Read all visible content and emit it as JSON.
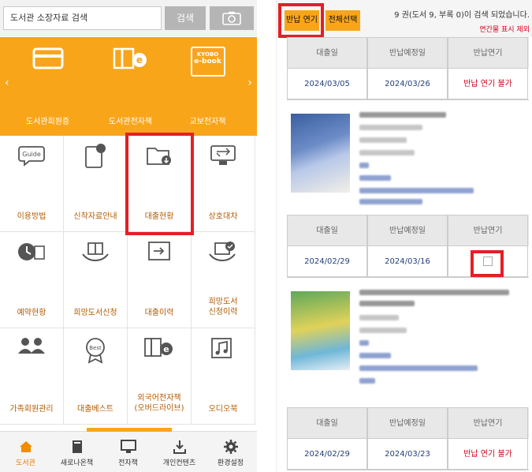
{
  "left": {
    "search": {
      "placeholder": "도서관 소장자료 검색",
      "button": "검색"
    },
    "banner": {
      "items": [
        {
          "label": "도서관회원증",
          "icon": "card-icon"
        },
        {
          "label": "도서관전자책",
          "icon": "ebook-icon"
        },
        {
          "label": "교보전자책",
          "icon": "kyobo-ebook-icon",
          "logo_top": "KYOBO",
          "logo_bottom": "e-book"
        }
      ]
    },
    "menu": [
      {
        "label": "이용방법",
        "icon": "guide-icon"
      },
      {
        "label": "신착자료안내",
        "icon": "new-arrival-icon"
      },
      {
        "label": "대출현황",
        "icon": "loan-status-icon"
      },
      {
        "label": "상호대차",
        "icon": "interlibrary-icon"
      },
      {
        "label": "예약현황",
        "icon": "reservation-icon"
      },
      {
        "label": "희망도서신청",
        "icon": "wish-book-icon"
      },
      {
        "label": "대출이력",
        "icon": "loan-history-icon"
      },
      {
        "label": "희망도서\n신청이력",
        "icon": "wish-history-icon"
      },
      {
        "label": "가족회원관리",
        "icon": "family-icon"
      },
      {
        "label": "대출베스트",
        "icon": "best-icon"
      },
      {
        "label": "외국어전자책\n(오버드라이브)",
        "icon": "foreign-ebook-icon"
      },
      {
        "label": "오디오북",
        "icon": "audiobook-icon"
      }
    ],
    "tabs": [
      {
        "label": "도서관",
        "icon": "home-icon",
        "active": true
      },
      {
        "label": "새로나온책",
        "icon": "book-icon",
        "active": false
      },
      {
        "label": "전자책",
        "icon": "monitor-icon",
        "active": false
      },
      {
        "label": "개인컨텐츠",
        "icon": "download-icon",
        "active": false
      },
      {
        "label": "환경설정",
        "icon": "gear-icon",
        "active": false
      }
    ]
  },
  "right": {
    "buttons": {
      "extend": "반납 연기",
      "select_all": "전체선택"
    },
    "result": "9 권(도서 9, 부록 0)이 검색 되었습니다.",
    "hide_link": "연간물 표시 제외",
    "columns": [
      "대출일",
      "반납예정일",
      "반납연기"
    ],
    "loans": [
      {
        "loan_date": "2024/03/05",
        "due_date": "2024/03/26",
        "extend": "반납 연기 불가"
      },
      {
        "loan_date": "2024/02/29",
        "due_date": "2024/03/16",
        "extend": ""
      },
      {
        "loan_date": "2024/02/29",
        "due_date": "2024/03/23",
        "extend": "반납 연기 불가"
      }
    ]
  },
  "colors": {
    "accent": "#f9a51a",
    "highlight": "#e41f26",
    "link_blue": "#223e7a",
    "warn_red": "#d0021b"
  }
}
